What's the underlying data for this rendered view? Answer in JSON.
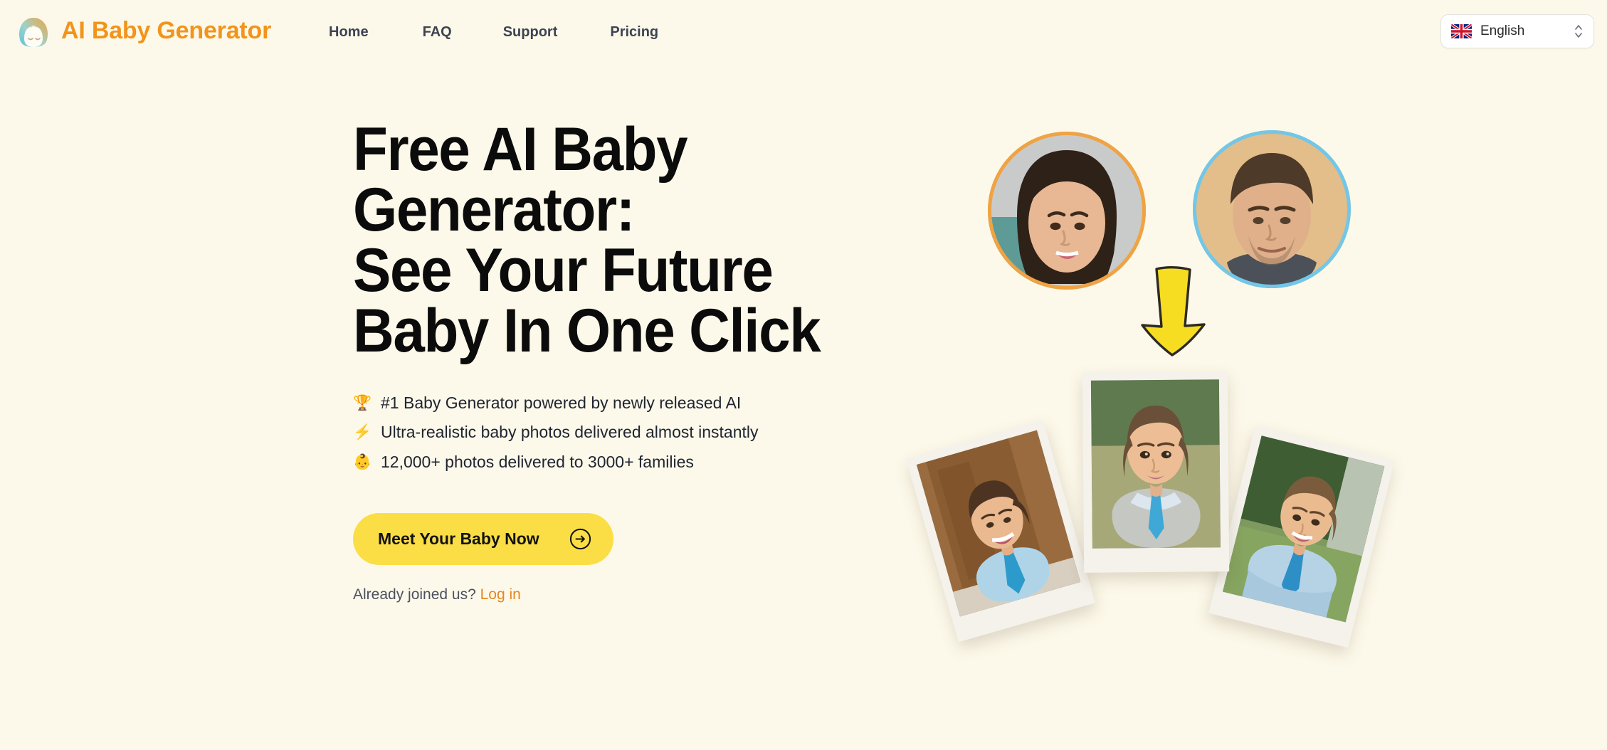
{
  "brand": {
    "name": "AI Baby Generator",
    "logo_icon": "baby-head-icon",
    "color": "#F2941C"
  },
  "nav": {
    "items": [
      {
        "label": "Home"
      },
      {
        "label": "FAQ"
      },
      {
        "label": "Support"
      },
      {
        "label": "Pricing"
      }
    ]
  },
  "language": {
    "selected": "English",
    "flag_icon": "uk-flag-icon",
    "chevron_icon": "chevron-up-down-icon"
  },
  "hero": {
    "headline": "Free AI Baby Generator:\nSee Your Future Baby In One Click",
    "bullets": [
      {
        "emoji": "🏆",
        "icon_name": "trophy-icon",
        "text": "#1 Baby Generator powered by newly released AI"
      },
      {
        "emoji": "⚡",
        "icon_name": "lightning-icon",
        "text": "Ultra-realistic baby photos delivered almost instantly"
      },
      {
        "emoji": "👶",
        "icon_name": "baby-icon",
        "text": "12,000+ photos delivered to 3000+ families"
      }
    ],
    "cta": {
      "label": "Meet Your Baby Now",
      "icon_name": "arrow-right-circle-icon",
      "bg_color": "#FBDE45"
    },
    "login_prompt": "Already joined us?",
    "login_label": "Log in",
    "login_color": "#E8851C"
  },
  "hero_media": {
    "mother": {
      "alt": "mother-portrait",
      "ring_color": "#F0A343"
    },
    "father": {
      "alt": "father-portrait",
      "ring_color": "#72C7E8"
    },
    "arrow_icon": "down-arrow-icon",
    "arrow_color": "#F7DD22",
    "baby_photos": [
      {
        "alt": "baby-photo-left"
      },
      {
        "alt": "baby-photo-center"
      },
      {
        "alt": "baby-photo-right"
      }
    ]
  },
  "theme": {
    "background": "#FDF9EA",
    "accent": "#F2941C",
    "cta": "#FBDE45",
    "nav_text": "#3D4352"
  }
}
